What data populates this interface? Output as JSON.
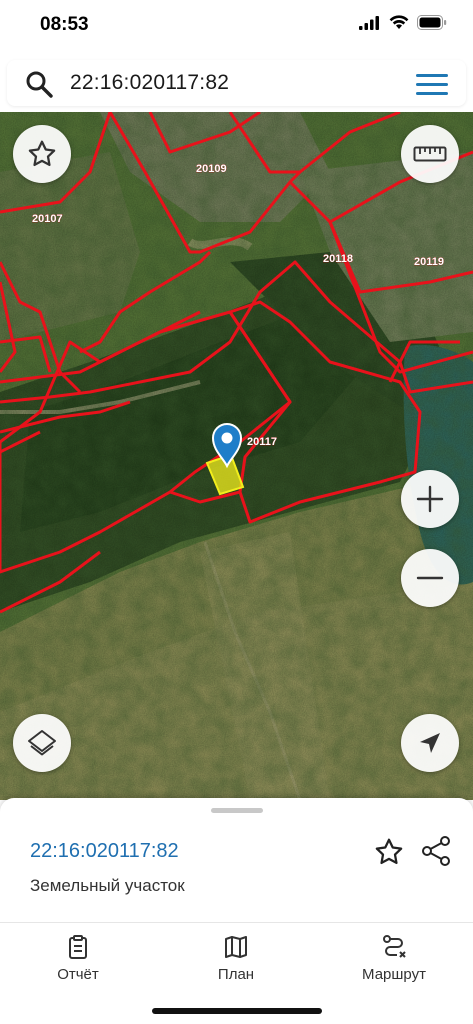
{
  "status_bar": {
    "time": "08:53"
  },
  "search": {
    "query": "22:16:020117:82"
  },
  "map": {
    "parcel_labels": [
      "20109",
      "20107",
      "20118",
      "20119",
      "20117"
    ],
    "boundary_color": "#e8121b",
    "selected_parcel_color": "#f2ee1c",
    "marker_color": "#1f7ec9"
  },
  "map_controls": {
    "favorite": "star-icon",
    "ruler": "ruler-icon",
    "zoom_in": "plus-icon",
    "zoom_out": "minus-icon",
    "layers": "layers-icon",
    "locate": "navigation-arrow-icon"
  },
  "sheet": {
    "parcel_id": "22:16:020117:82",
    "parcel_type": "Земельный участок"
  },
  "tabs": [
    {
      "label": "Отчёт",
      "icon": "clipboard-icon"
    },
    {
      "label": "План",
      "icon": "map-fold-icon"
    },
    {
      "label": "Маршрут",
      "icon": "route-icon"
    }
  ],
  "colors": {
    "accent": "#1f78b4",
    "link": "#1f6fb0"
  }
}
